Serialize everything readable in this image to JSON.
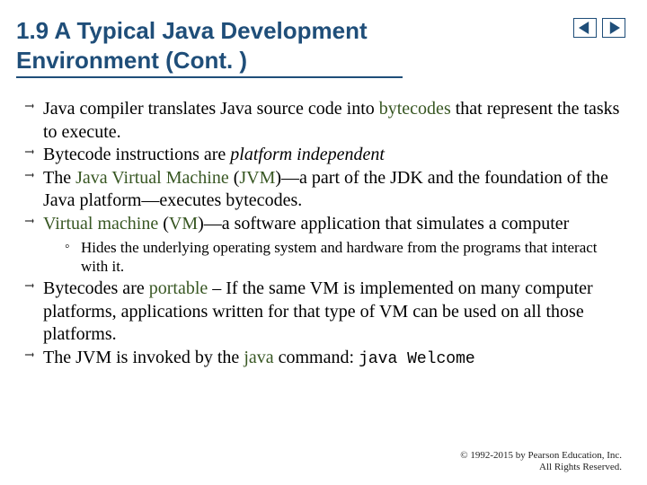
{
  "title": "1.9  A Typical Java Development Environment (Cont. )",
  "bullets": {
    "b1_a": "Java compiler translates Java source code into ",
    "b1_term": "bytecodes",
    "b1_b": " that represent the tasks to execute.",
    "b2_a": "Bytecode instructions are ",
    "b2_em": "platform independent",
    "b3_a": "The ",
    "b3_term1": "Java Virtual Machine",
    "b3_b": " (",
    "b3_term2": "JVM",
    "b3_c": ")—a part of the JDK and the foundation of the Java platform—executes bytecodes.",
    "b4_term1": "Virtual machine",
    "b4_a": " (",
    "b4_term2": "VM",
    "b4_b": ")—a software application that simulates a computer",
    "b4_sub": "Hides the underlying operating system and hardware from the programs that interact with it.",
    "b5_a": "Bytecodes are ",
    "b5_term": "portable",
    "b5_b": " – If the same VM is implemented on many computer platforms, applications written for that type of VM can be used on all those platforms.",
    "b6_a": "The JVM is invoked by the ",
    "b6_term": "java",
    "b6_b": " command: ",
    "b6_code": "java Welcome"
  },
  "footer": {
    "line1": "© 1992-2015 by Pearson Education, Inc.",
    "line2": "All Rights Reserved."
  }
}
